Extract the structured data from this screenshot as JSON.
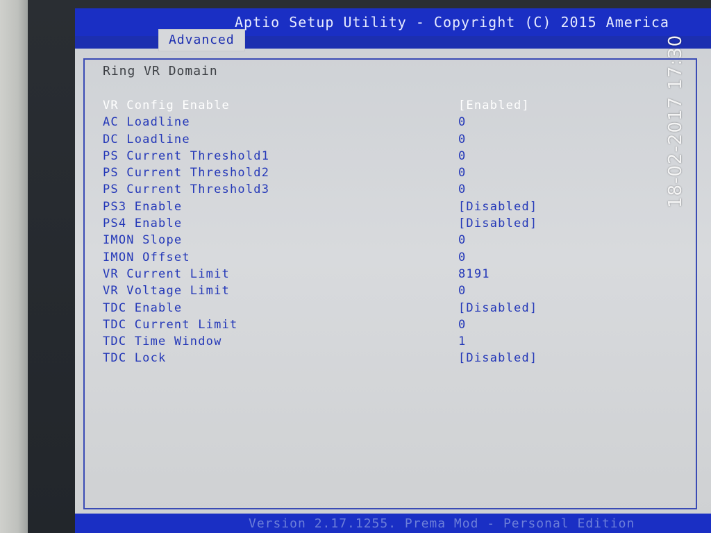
{
  "header": {
    "title": "Aptio Setup Utility - Copyright (C) 2015 America",
    "active_tab": "Advanced"
  },
  "section_title": "Ring VR Domain",
  "settings": [
    {
      "label": "VR Config Enable",
      "value": "[Enabled]",
      "selected": true
    },
    {
      "label": "AC Loadline",
      "value": "0"
    },
    {
      "label": "DC Loadline",
      "value": "0"
    },
    {
      "label": "PS Current Threshold1",
      "value": "0"
    },
    {
      "label": "PS Current Threshold2",
      "value": "0"
    },
    {
      "label": "PS Current Threshold3",
      "value": "0"
    },
    {
      "label": "PS3 Enable",
      "value": "[Disabled]"
    },
    {
      "label": "PS4 Enable",
      "value": "[Disabled]"
    },
    {
      "label": "IMON Slope",
      "value": "0"
    },
    {
      "label": "IMON Offset",
      "value": "0"
    },
    {
      "label": "VR Current Limit",
      "value": "8191"
    },
    {
      "label": "VR Voltage Limit",
      "value": "0"
    },
    {
      "label": "TDC Enable",
      "value": "[Disabled]"
    },
    {
      "label": "TDC Current Limit",
      "value": "0"
    },
    {
      "label": "TDC Time Window",
      "value": "1"
    },
    {
      "label": "TDC Lock",
      "value": "[Disabled]"
    }
  ],
  "footer": {
    "version": "Version 2.17.1255. Prema Mod - Personal Edition"
  },
  "photo_timestamp": "18-02-2017 17:30",
  "colors": {
    "bios_blue": "#1a2fc4",
    "panel_gray": "#d6d8db",
    "text_blue": "#2438b8",
    "selected_text": "#ffffff"
  }
}
